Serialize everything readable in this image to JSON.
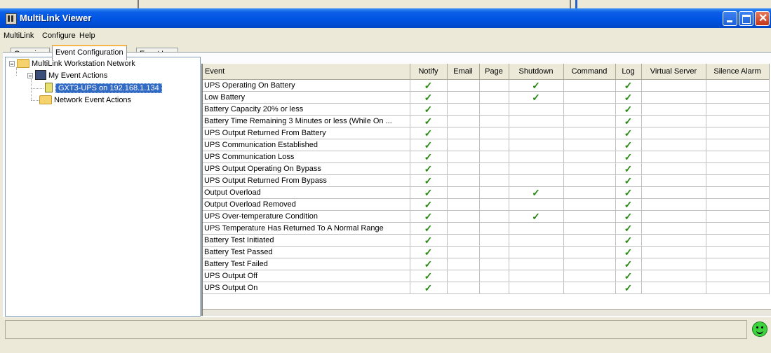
{
  "window": {
    "title": "MultiLink Viewer"
  },
  "menu": [
    "MultiLink",
    "Configure",
    "Help"
  ],
  "tabs": [
    "Overview",
    "Event Configuration",
    "Event Log"
  ],
  "active_tab": "Event Configuration",
  "tree": {
    "root": "MultiLink Workstation Network",
    "my_actions": "My Event Actions",
    "device": "GXT3-UPS on 192.168.1.134",
    "network_actions": "Network Event Actions"
  },
  "grid": {
    "columns": [
      "Event",
      "Notify",
      "Email",
      "Page",
      "Shutdown",
      "Command",
      "Log",
      "Virtual Server",
      "Silence Alarm"
    ],
    "check_glyph": "✓",
    "rows": [
      {
        "event": "UPS Operating On Battery",
        "checks": [
          true,
          false,
          false,
          true,
          false,
          true,
          false,
          false
        ]
      },
      {
        "event": "Low Battery",
        "checks": [
          true,
          false,
          false,
          true,
          false,
          true,
          false,
          false
        ]
      },
      {
        "event": "Battery Capacity 20% or less",
        "checks": [
          true,
          false,
          false,
          false,
          false,
          true,
          false,
          false
        ]
      },
      {
        "event": "Battery Time Remaining 3 Minutes or less (While On ...",
        "checks": [
          true,
          false,
          false,
          false,
          false,
          true,
          false,
          false
        ]
      },
      {
        "event": "UPS Output Returned From Battery",
        "checks": [
          true,
          false,
          false,
          false,
          false,
          true,
          false,
          false
        ]
      },
      {
        "event": "UPS Communication Established",
        "checks": [
          true,
          false,
          false,
          false,
          false,
          true,
          false,
          false
        ]
      },
      {
        "event": "UPS Communication Loss",
        "checks": [
          true,
          false,
          false,
          false,
          false,
          true,
          false,
          false
        ]
      },
      {
        "event": "UPS Output Operating On Bypass",
        "checks": [
          true,
          false,
          false,
          false,
          false,
          true,
          false,
          false
        ]
      },
      {
        "event": "UPS Output Returned From Bypass",
        "checks": [
          true,
          false,
          false,
          false,
          false,
          true,
          false,
          false
        ]
      },
      {
        "event": "Output Overload",
        "checks": [
          true,
          false,
          false,
          true,
          false,
          true,
          false,
          false
        ]
      },
      {
        "event": "Output Overload Removed",
        "checks": [
          true,
          false,
          false,
          false,
          false,
          true,
          false,
          false
        ]
      },
      {
        "event": "UPS Over-temperature Condition",
        "checks": [
          true,
          false,
          false,
          true,
          false,
          true,
          false,
          false
        ]
      },
      {
        "event": "UPS Temperature Has Returned To A Normal Range",
        "checks": [
          true,
          false,
          false,
          false,
          false,
          true,
          false,
          false
        ]
      },
      {
        "event": "Battery Test Initiated",
        "checks": [
          true,
          false,
          false,
          false,
          false,
          true,
          false,
          false
        ]
      },
      {
        "event": "Battery Test Passed",
        "checks": [
          true,
          false,
          false,
          false,
          false,
          true,
          false,
          false
        ]
      },
      {
        "event": "Battery Test Failed",
        "checks": [
          true,
          false,
          false,
          false,
          false,
          true,
          false,
          false
        ]
      },
      {
        "event": "UPS Output Off",
        "checks": [
          true,
          false,
          false,
          false,
          false,
          true,
          false,
          false
        ]
      },
      {
        "event": "UPS Output On",
        "checks": [
          true,
          false,
          false,
          false,
          false,
          true,
          false,
          false
        ]
      }
    ]
  },
  "status": {
    "icon": "smiley-ok-icon"
  }
}
